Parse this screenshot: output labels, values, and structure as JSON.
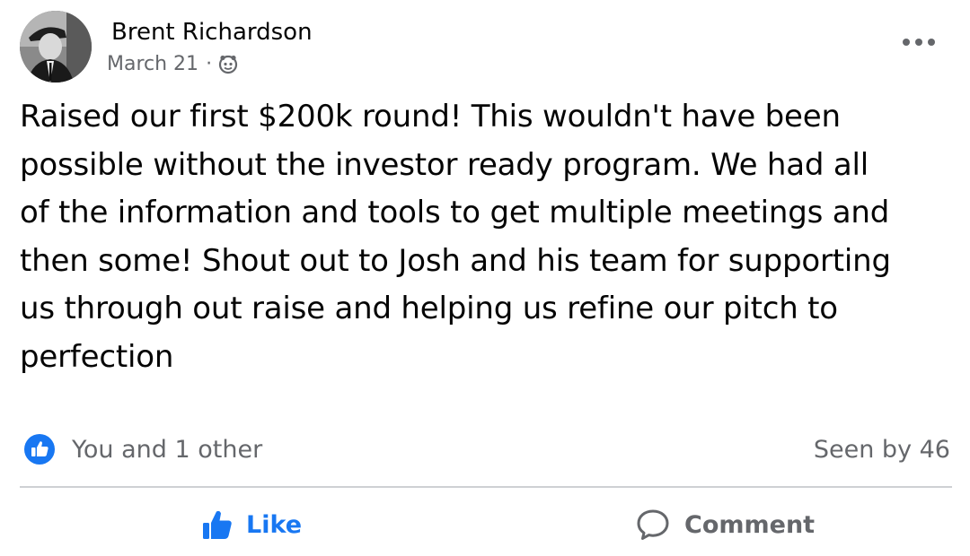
{
  "post": {
    "author": "Brent Richardson",
    "date": "March 21",
    "separator": "·",
    "audience_icon": "friends-icon",
    "text": "Raised our first $200k round! This wouldn't have been\npossible without the investor ready program. We had all\nof the information and tools to get multiple meetings and\nthen some! Shout out to Josh and his team for supporting\nus through out raise and helping us refine our pitch to\nperfection"
  },
  "reactions": {
    "summary": "You and 1 other",
    "seen_by": "Seen by 46"
  },
  "actions": {
    "like_label": "Like",
    "comment_label": "Comment"
  },
  "colors": {
    "brand_blue": "#1877f2",
    "secondary_text": "#65676b",
    "primary_text": "#050505",
    "divider": "#ced0d4"
  }
}
